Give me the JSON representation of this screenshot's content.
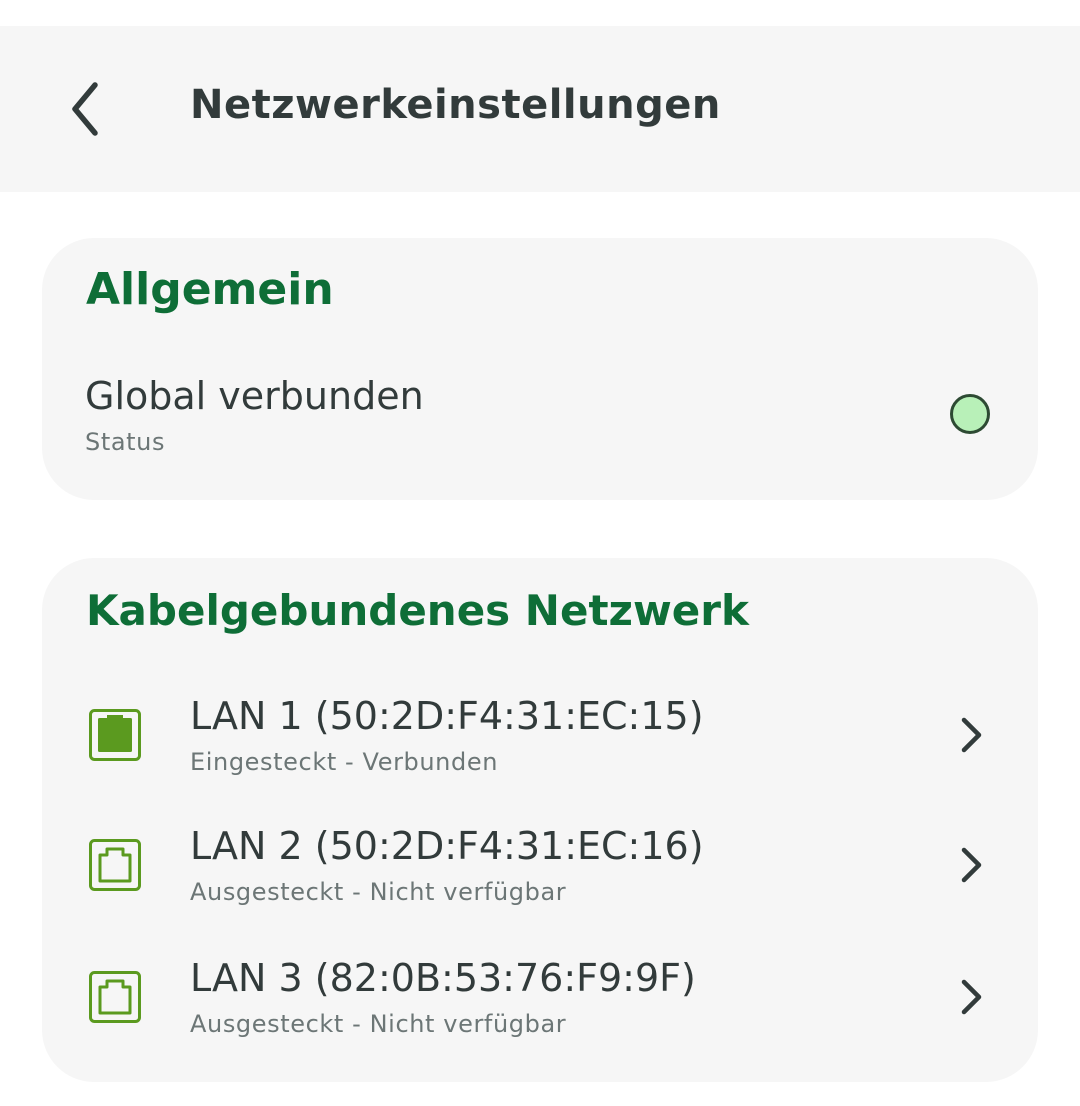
{
  "header": {
    "title": "Netzwerkeinstellungen"
  },
  "general": {
    "title": "Allgemein",
    "status_value": "Global verbunden",
    "status_label": "Status",
    "status_color": "#b8f0b8"
  },
  "wired": {
    "title": "Kabelgebundenes Netzwerk",
    "items": [
      {
        "label": "LAN 1 (50:2D:F4:31:EC:15)",
        "status": "Eingesteckt - Verbunden",
        "icon": "ethernet-port-filled-icon"
      },
      {
        "label": "LAN 2 (50:2D:F4:31:EC:16)",
        "status": "Ausgesteckt - Nicht verfügbar",
        "icon": "ethernet-port-outline-icon"
      },
      {
        "label": "LAN 3 (82:0B:53:76:F9:9F)",
        "status": "Ausgesteckt - Nicht verfügbar",
        "icon": "ethernet-port-outline-icon"
      }
    ]
  },
  "colors": {
    "accent": "#0e6e37",
    "icon_green": "#5b9a1f",
    "text": "#323b3b",
    "subtext": "#6c7676",
    "card_bg": "#f6f6f6"
  }
}
